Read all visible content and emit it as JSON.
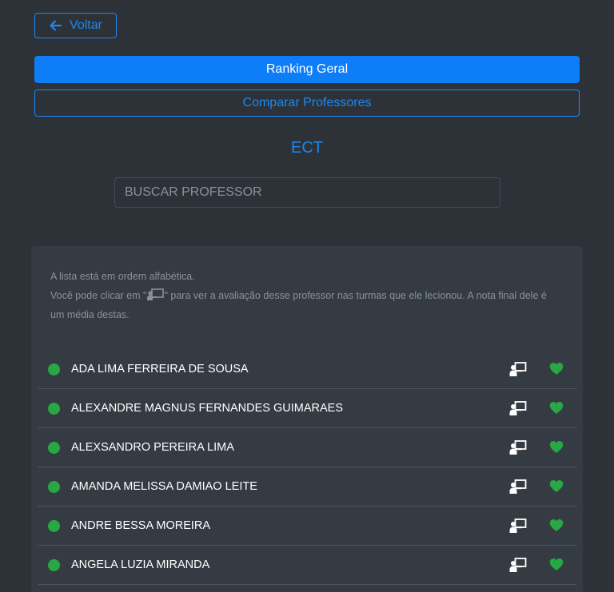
{
  "header": {
    "back_label": "Voltar"
  },
  "actions": {
    "ranking_label": "Ranking Geral",
    "compare_label": "Comparar Professores"
  },
  "section": {
    "title": "ECT"
  },
  "search": {
    "placeholder": "BUSCAR PROFESSOR",
    "value": ""
  },
  "info": {
    "line1": "A lista está em ordem alfabética.",
    "line2_prefix": "Você pode clicar em \"",
    "line2_suffix": "\" para ver a avaliação desse professor nas turmas que ele lecionou. A nota final dele é um média destas."
  },
  "professors": [
    {
      "name": "ADA LIMA FERREIRA DE SOUSA",
      "status": "green"
    },
    {
      "name": "ALEXANDRE MAGNUS FERNANDES GUIMARAES",
      "status": "green"
    },
    {
      "name": "ALEXSANDRO PEREIRA LIMA",
      "status": "green"
    },
    {
      "name": "AMANDA MELISSA DAMIAO LEITE",
      "status": "green"
    },
    {
      "name": "ANDRE BESSA MOREIRA",
      "status": "green"
    },
    {
      "name": "ANGELA LUZIA MIRANDA",
      "status": "green"
    }
  ],
  "icons": {
    "back": "arrow-left-icon",
    "class": "chalkboard-teacher-icon",
    "favorite": "heart-icon"
  },
  "colors": {
    "background": "#2d3238",
    "card": "#353b43",
    "accent": "#0d7df8",
    "status_green": "#28a745"
  }
}
